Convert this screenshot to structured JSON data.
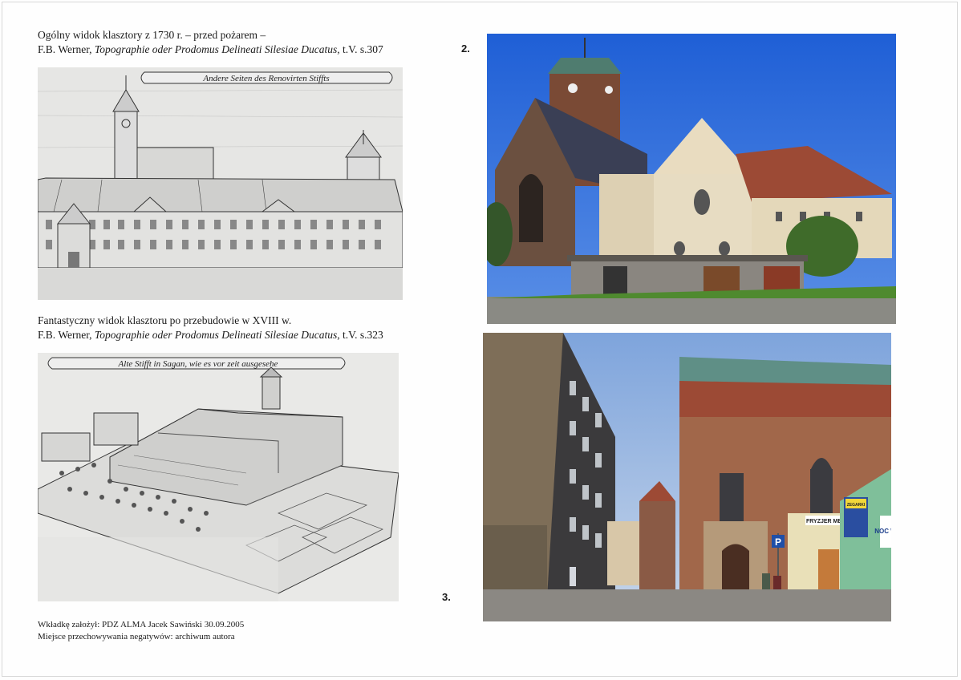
{
  "caption1": {
    "line1": "Ogólny widok klasztory z 1730 r. – przed pożarem –",
    "author": "F.B. Werner, ",
    "work": "Topographie oder Prodomus Delineati Silesiae Ducatus",
    "ref": ", t.V. s.307"
  },
  "caption2": {
    "line1": "Fantastyczny widok klasztoru po przebudowie  w XVIII w.",
    "author": "F.B. Werner, ",
    "work": "Topographie oder Prodomus Delineati Silesiae Ducatus",
    "ref": ", t.V. s.323"
  },
  "numbers": {
    "photo2": "2.",
    "photo3": "3."
  },
  "drawing1_banner": "Andere Seiten des Renovirten Stiffts",
  "drawing2_banner": "Alte Stifft in Sagan, wie es vor zeit ausgesehe",
  "photo3_signs": {
    "shop": "FRYZJER MĘ",
    "parking": "P",
    "left_sign": "ZEGARKI",
    "right_sign": "NOC W"
  },
  "footer": {
    "line1": "Wkładkę założył: PDZ ALMA Jacek Sawiński   30.09.2005",
    "line2": "Miejsce przechowywania negatywów: archiwum autora"
  }
}
